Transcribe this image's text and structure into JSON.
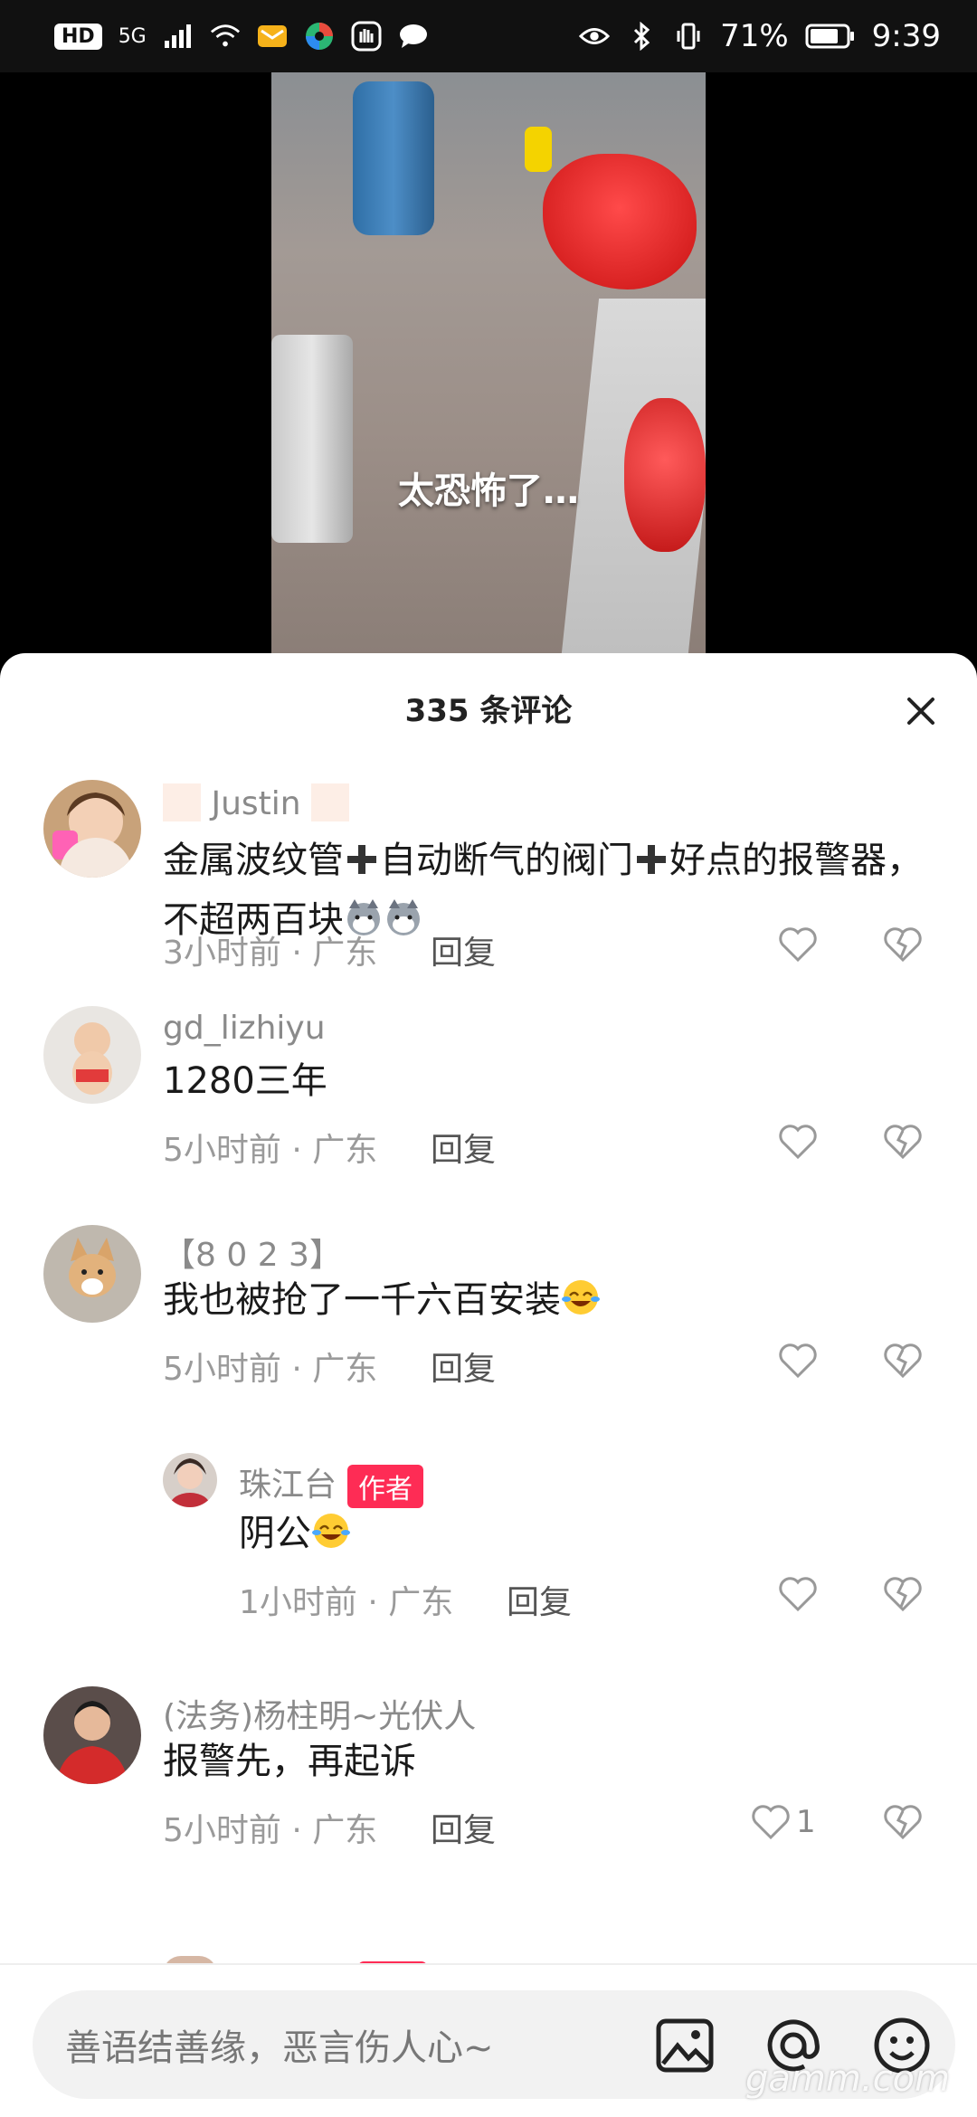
{
  "status_bar": {
    "left_badge": "HD",
    "network": "5G",
    "battery": "71%",
    "time": "9:39"
  },
  "video": {
    "caption": "太恐怖了…"
  },
  "panel": {
    "title": "335 条评论"
  },
  "comments": [
    {
      "username_core": "Justin",
      "text_parts": [
        "金属波纹管",
        "自动断气的阀门",
        "好点的报警器，不超两百块"
      ],
      "time": "3小时前 · 广东",
      "reply_label": "回复",
      "likes": ""
    },
    {
      "username": "gd_lizhiyu",
      "text": "1280三年",
      "time": "5小时前 · 广东",
      "reply_label": "回复",
      "likes": ""
    },
    {
      "username": "【8 0 2 3】",
      "text": "我也被抢了一千六百安装",
      "time": "5小时前 · 广东",
      "reply_label": "回复",
      "likes": ""
    },
    {
      "username": "珠江台",
      "badge": "作者",
      "text": "阴公",
      "time": "1小时前 · 广东",
      "reply_label": "回复",
      "likes": ""
    },
    {
      "username": "(法务)杨柱明~光伏人",
      "text": "报警先，再起诉",
      "time": "5小时前 · 广东",
      "reply_label": "回复",
      "likes": "1"
    }
  ],
  "input": {
    "placeholder": "善语结善缘，恶言伤人心~"
  },
  "watermark": "gamm.com",
  "colors": {
    "accent": "#fe2c55",
    "text_primary": "#1a1a1a",
    "text_secondary": "#8a8a8a"
  }
}
